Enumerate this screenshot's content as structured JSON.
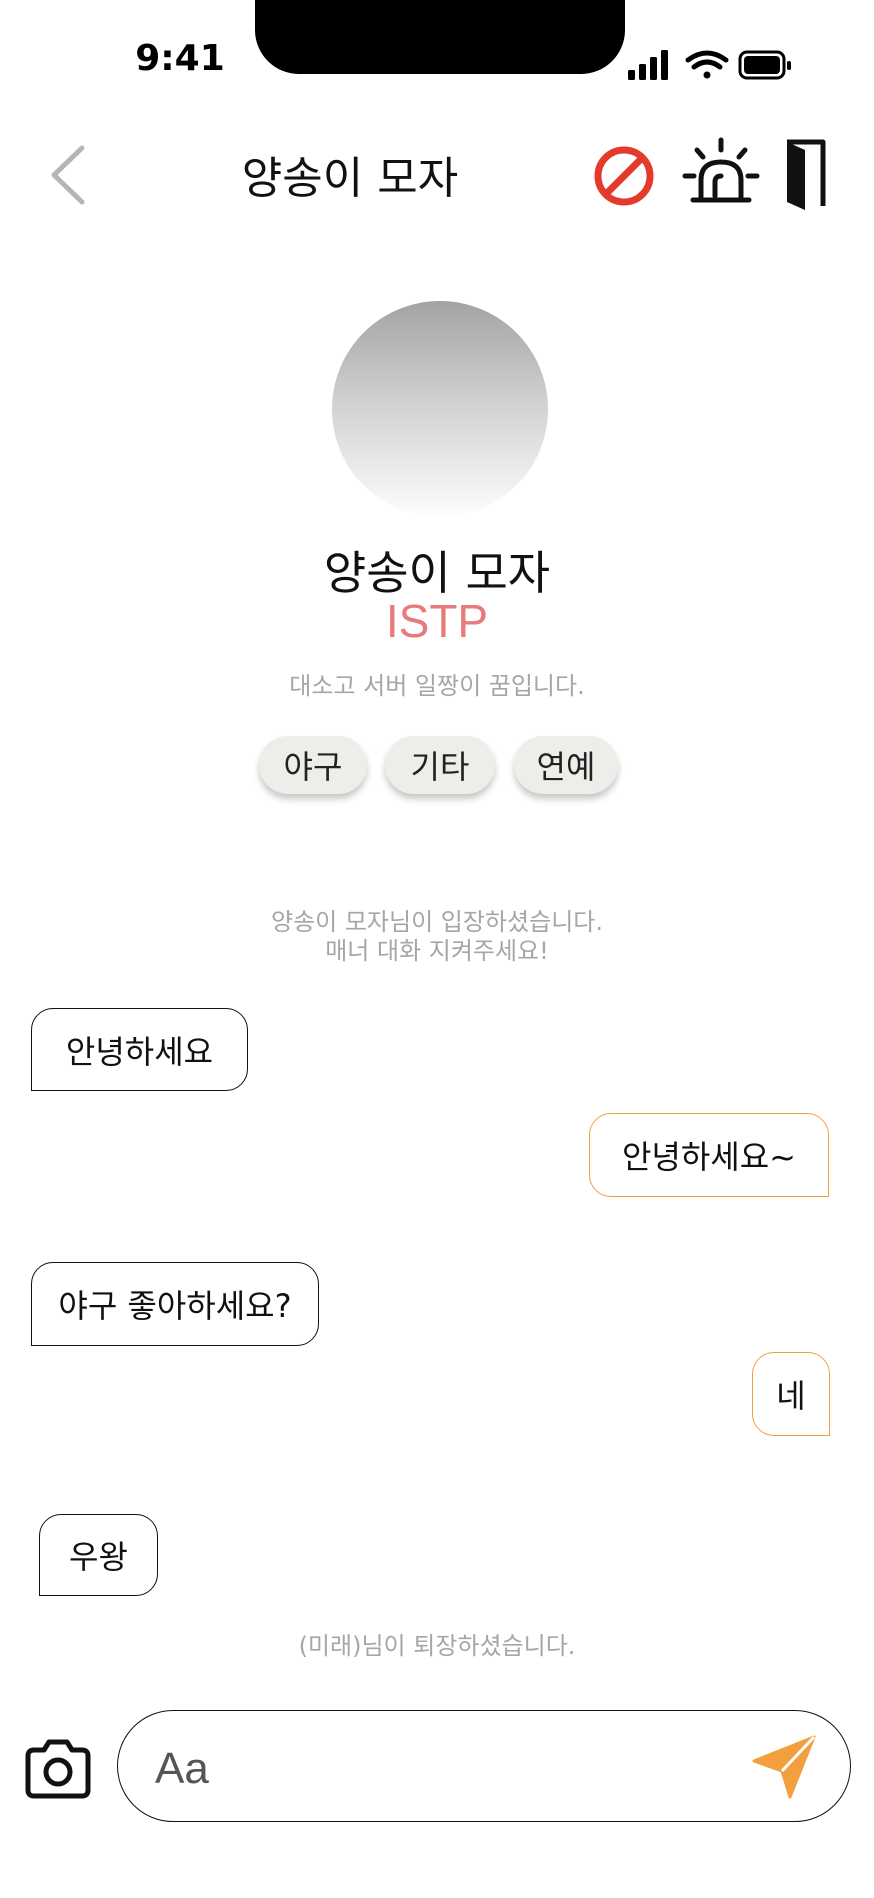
{
  "status_bar": {
    "time": "9:41"
  },
  "header": {
    "title": "양송이 모자"
  },
  "profile": {
    "name": "양송이 모자",
    "mbti": "ISTP",
    "bio": "대소고 서버 일짱이 꿈입니다.",
    "tags": [
      "야구",
      "기타",
      "연예"
    ]
  },
  "system": {
    "enter_line1": "양송이 모자님이 입장하셨습니다.",
    "enter_line2": "매너 대화 지켜주세요!",
    "leave": "(미래)님이 퇴장하셨습니다."
  },
  "messages": [
    {
      "side": "in",
      "text": "안녕하세요"
    },
    {
      "side": "out",
      "text": "안녕하세요~"
    },
    {
      "side": "in",
      "text": "야구 좋아하세요?"
    },
    {
      "side": "out",
      "text": "네"
    },
    {
      "side": "in",
      "text": "우왕"
    }
  ],
  "input": {
    "placeholder": "Aa"
  },
  "colors": {
    "accent": "#f2a03d",
    "block_red": "#e33a2b",
    "mbti": "#e97a7a"
  },
  "icons": {
    "back": "chevron-left-icon",
    "block": "block-icon",
    "report": "siren-icon",
    "exit": "door-icon",
    "camera": "camera-icon",
    "send": "send-icon"
  }
}
